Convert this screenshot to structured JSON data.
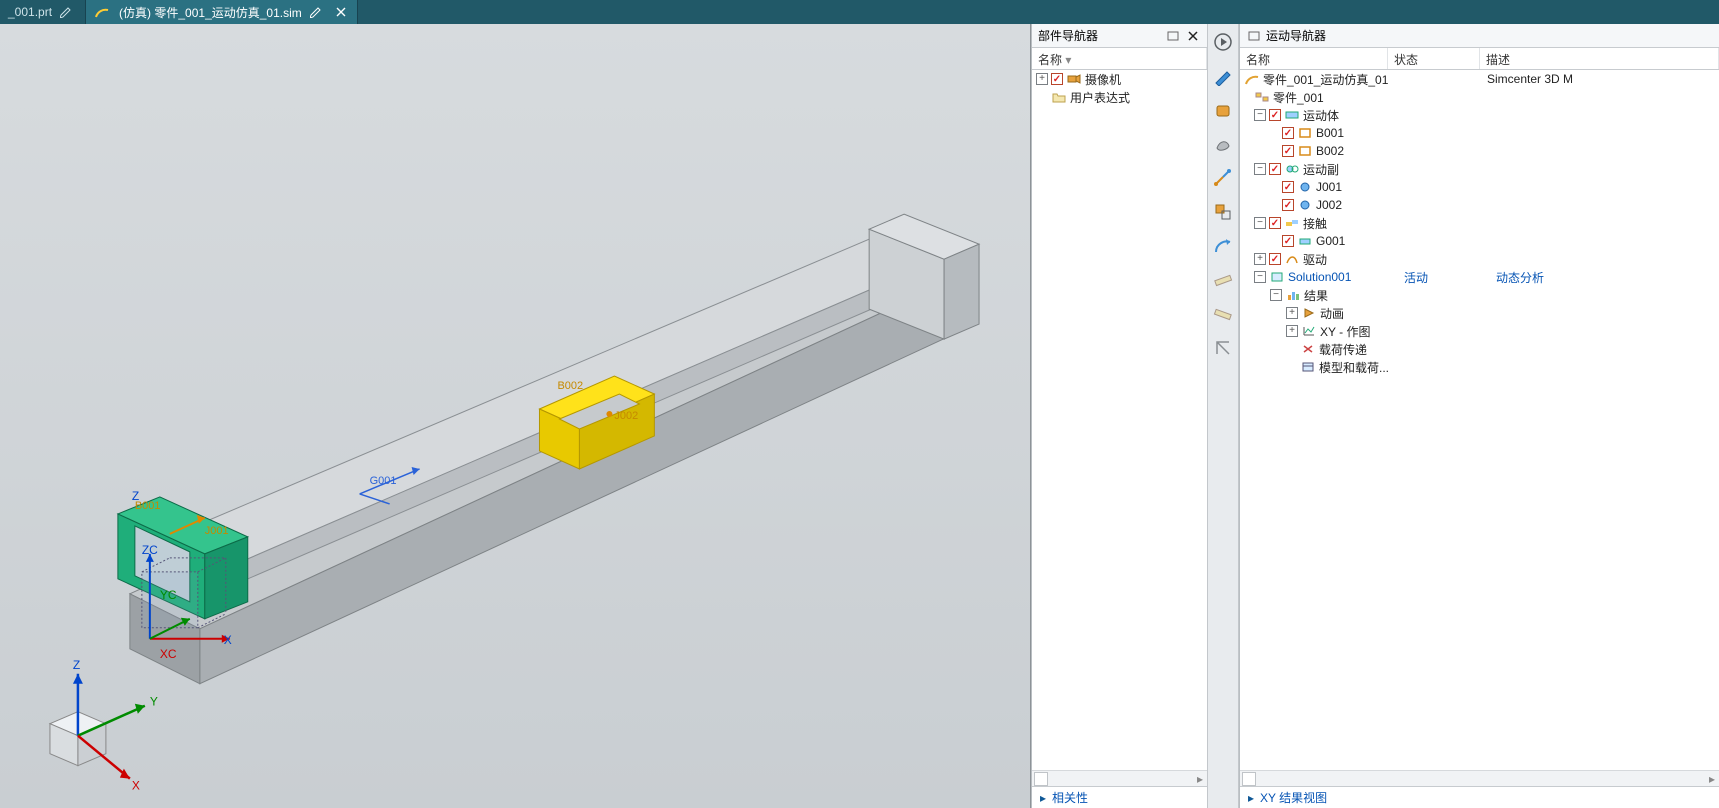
{
  "tabs": {
    "inactive": {
      "label": "_001.prt",
      "modified_icon": true
    },
    "active": {
      "prefix_icon": "sim-arc-icon",
      "label": "(仿真) 零件_001_运动仿真_01.sim",
      "modified": true,
      "closable": true
    }
  },
  "viewport": {
    "body_labels": {
      "B001": "B001",
      "B002": "B002"
    },
    "joint_labels": {
      "J001": "J001",
      "J002": "J002"
    },
    "gear_labels": {
      "G001": "G001"
    },
    "triad_small": {
      "X": "X",
      "Y": "Y",
      "Z": "Z"
    },
    "triad_wcs": {
      "XC": "XC",
      "YC": "YC",
      "ZC": "ZC",
      "X": "X",
      "Z": "Z"
    }
  },
  "part_nav": {
    "title": "部件导航器",
    "columns": {
      "name": "名称"
    },
    "nodes": {
      "cameras_label": "摄像机",
      "user_expr_label": "用户表达式"
    },
    "footer_section": "相关性"
  },
  "motion_nav": {
    "title": "运动导航器",
    "columns": {
      "name": "名称",
      "status": "状态",
      "desc": "描述"
    },
    "root": {
      "label": "零件_001_运动仿真_01",
      "desc": "Simcenter 3D M"
    },
    "part": {
      "label": "零件_001"
    },
    "motion_bodies": {
      "group_label": "运动体",
      "items": [
        "B001",
        "B002"
      ]
    },
    "joints": {
      "group_label": "运动副",
      "items": [
        "J001",
        "J002"
      ]
    },
    "contacts": {
      "group_label": "接触",
      "items": [
        "G001"
      ]
    },
    "drivers_label": "驱动",
    "solution": {
      "label": "Solution001",
      "status": "活动",
      "desc": "动态分析",
      "results_label": "结果",
      "anim_label": "动画",
      "xy_label": "XY - 作图",
      "load_xfer_label": "载荷传递",
      "model_load_label": "模型和载荷..."
    },
    "footer_section": "XY 结果视图"
  },
  "vstrip_icons": [
    "play-circle-icon",
    "probe-icon",
    "body-icon",
    "foot-icon",
    "measure-pair-icon",
    "box-link-icon",
    "curve-arrow-icon",
    "ruler-icon",
    "ruler2-icon",
    "caliper-icon"
  ]
}
